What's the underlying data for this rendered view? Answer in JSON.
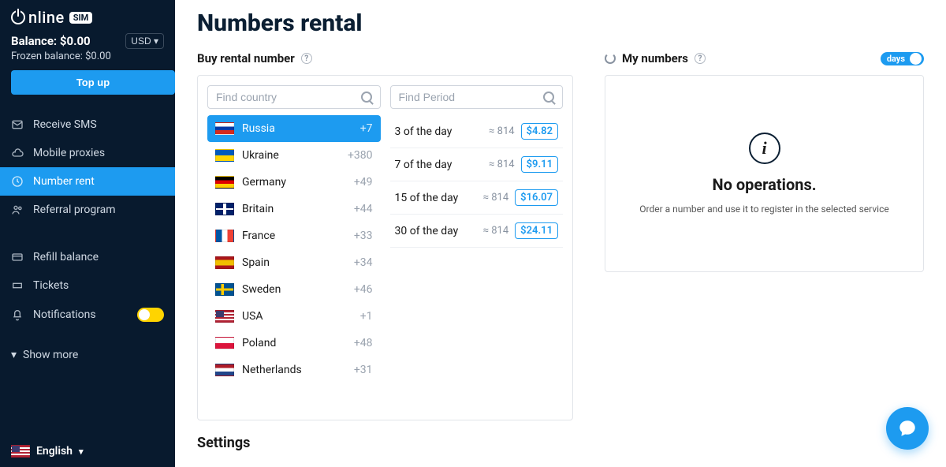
{
  "brand": {
    "name": "nline",
    "badge": "SIM"
  },
  "balance": {
    "label": "Balance:",
    "value": "$0.00",
    "currency": "USD",
    "frozen_label": "Frozen balance:",
    "frozen_value": "$0.00",
    "topup": "Top up"
  },
  "nav": {
    "items": [
      {
        "label": "Receive SMS",
        "icon": "mail-icon"
      },
      {
        "label": "Mobile proxies",
        "icon": "cloud-icon"
      },
      {
        "label": "Number rent",
        "icon": "clock-icon",
        "active": true
      },
      {
        "label": "Referral program",
        "icon": "users-icon"
      }
    ],
    "items2": [
      {
        "label": "Refill balance",
        "icon": "card-icon"
      },
      {
        "label": "Tickets",
        "icon": "ticket-icon"
      },
      {
        "label": "Notifications",
        "icon": "bell-icon",
        "toggle": true
      }
    ],
    "show_more": "Show more",
    "language": "English"
  },
  "page": {
    "title": "Numbers rental",
    "buy_section": "Buy rental number",
    "my_section": "My numbers",
    "days_label": "days",
    "settings": "Settings"
  },
  "search": {
    "country_placeholder": "Find country",
    "period_placeholder": "Find Period"
  },
  "countries": [
    {
      "name": "Russia",
      "code": "+7",
      "flag": "flag-ru",
      "active": true
    },
    {
      "name": "Ukraine",
      "code": "+380",
      "flag": "flag-ua"
    },
    {
      "name": "Germany",
      "code": "+49",
      "flag": "flag-de"
    },
    {
      "name": "Britain",
      "code": "+44",
      "flag": "flag-gb"
    },
    {
      "name": "France",
      "code": "+33",
      "flag": "flag-fr"
    },
    {
      "name": "Spain",
      "code": "+34",
      "flag": "flag-es"
    },
    {
      "name": "Sweden",
      "code": "+46",
      "flag": "flag-se"
    },
    {
      "name": "USA",
      "code": "+1",
      "flag": "flag-us"
    },
    {
      "name": "Poland",
      "code": "+48",
      "flag": "flag-pl"
    },
    {
      "name": "Netherlands",
      "code": "+31",
      "flag": "flag-nl"
    }
  ],
  "periods": [
    {
      "label": "3 of the day",
      "approx": "≈ 814",
      "price": "$4.82"
    },
    {
      "label": "7 of the day",
      "approx": "≈ 814",
      "price": "$9.11"
    },
    {
      "label": "15 of the day",
      "approx": "≈ 814",
      "price": "$16.07"
    },
    {
      "label": "30 of the day",
      "approx": "≈ 814",
      "price": "$24.11"
    }
  ],
  "my_numbers": {
    "empty_title": "No operations.",
    "empty_sub": "Order a number and use it to register in the selected service"
  }
}
